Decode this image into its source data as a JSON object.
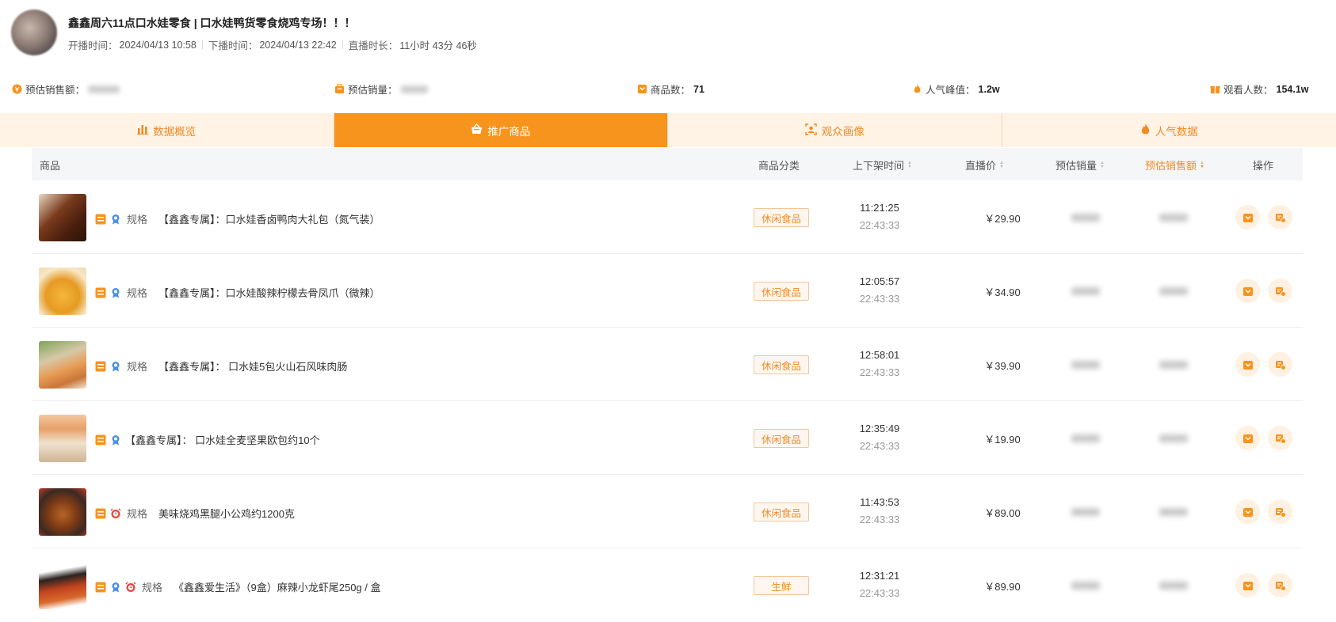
{
  "stream": {
    "title": "鑫鑫周六11点口水娃零食 | 口水娃鸭货零食烧鸡专场！！！",
    "start_label": "开播时间：",
    "start_value": "2024/04/13 10:58",
    "end_label": "下播时间：",
    "end_value": "2024/04/13 22:42",
    "duration_label": "直播时长：",
    "duration_value": "11小时 43分 46秒"
  },
  "stats": [
    {
      "label": "预估销售额：",
      "value": "",
      "icon": "coin-icon"
    },
    {
      "label": "预估销量：",
      "value": "",
      "icon": "bag-icon"
    },
    {
      "label": "商品数：",
      "value": "71",
      "icon": "goods-icon"
    },
    {
      "label": "人气峰值：",
      "value": "1.2w",
      "icon": "fire-icon"
    },
    {
      "label": "观看人数：",
      "value": "154.1w",
      "icon": "gift-icon"
    }
  ],
  "tabs": [
    {
      "label": "数据概览",
      "icon": "bar-chart-icon",
      "active": false
    },
    {
      "label": "推广商品",
      "icon": "basket-icon",
      "active": true
    },
    {
      "label": "观众画像",
      "icon": "face-scan-icon",
      "active": false
    },
    {
      "label": "人气数据",
      "icon": "fire-icon",
      "active": false
    }
  ],
  "table": {
    "columns": {
      "product": "商品",
      "category": "商品分类",
      "shelf_time": "上下架时间",
      "price": "直播价",
      "sales": "预估销量",
      "revenue": "预估销售额",
      "ops": "操作"
    },
    "rows": [
      {
        "spec": "规格",
        "name": "【鑫鑫专属】：口水娃香卤鸭肉大礼包（氮气装）",
        "category": "休闲食品",
        "on_time": "11:21:25",
        "off_time": "22:43:33",
        "price": "￥29.90"
      },
      {
        "spec": "规格",
        "name": "【鑫鑫专属】：口水娃酸辣柠檬去骨凤爪（微辣）",
        "category": "休闲食品",
        "on_time": "12:05:57",
        "off_time": "22:43:33",
        "price": "￥34.90"
      },
      {
        "spec": "规格",
        "name": "【鑫鑫专属】： 口水娃5包火山石风味肉肠",
        "category": "休闲食品",
        "on_time": "12:58:01",
        "off_time": "22:43:33",
        "price": "￥39.90"
      },
      {
        "spec": "",
        "name": "【鑫鑫专属】： 口水娃全麦坚果欧包约10个",
        "category": "休闲食品",
        "on_time": "12:35:49",
        "off_time": "22:43:33",
        "price": "￥19.90"
      },
      {
        "spec": "规格",
        "name": "美味烧鸡黑腿小公鸡约1200克",
        "category": "休闲食品",
        "on_time": "11:43:53",
        "off_time": "22:43:33",
        "price": "￥89.00"
      },
      {
        "spec": "规格",
        "name": "《鑫鑫爱生活》（9盒）麻辣小龙虾尾250g / 盒",
        "category": "生鲜",
        "on_time": "12:31:21",
        "off_time": "22:43:33",
        "price": "￥89.90"
      }
    ]
  },
  "colors": {
    "accent": "#f7941d",
    "tab_bg": "#fff3e6",
    "badge_border": "#f5c59a"
  }
}
